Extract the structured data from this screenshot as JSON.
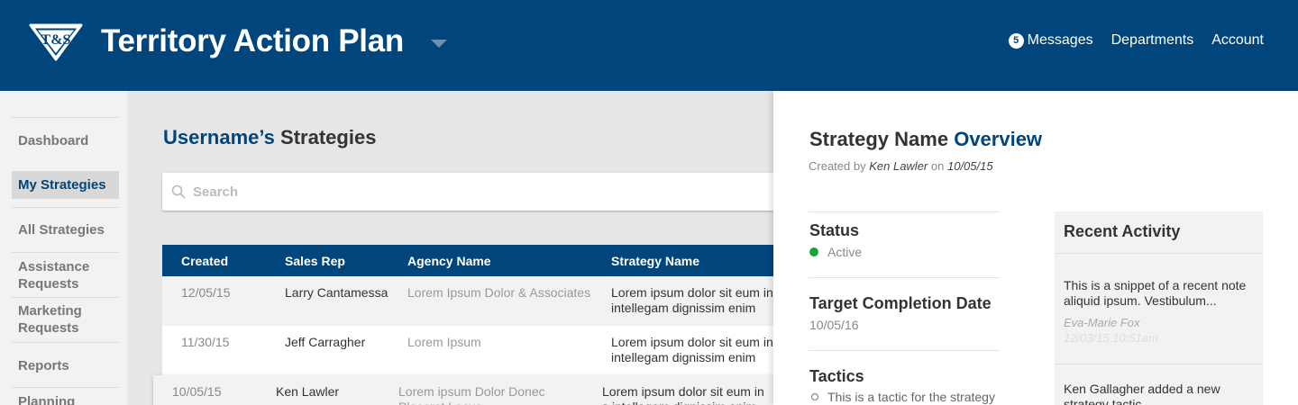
{
  "header": {
    "logo_text": "T&S",
    "title": "Territory Action Plan",
    "nav": {
      "messages_count": "5",
      "messages_label": "Messages",
      "departments_label": "Departments",
      "account_label": "Account"
    }
  },
  "sidebar": {
    "items": [
      {
        "label": "Dashboard",
        "active": false
      },
      {
        "label": "My Strategies",
        "active": true
      },
      {
        "label": "All Strategies",
        "active": false
      },
      {
        "label": "Assistance Requests",
        "active": false
      },
      {
        "label": "Marketing Requests",
        "active": false
      },
      {
        "label": "Reports",
        "active": false
      },
      {
        "label": "Planning",
        "active": false
      }
    ]
  },
  "main": {
    "title_user": "Username’s",
    "title_rest": "Strategies",
    "search": {
      "placeholder": "Search",
      "value": ""
    },
    "table": {
      "columns": [
        "Created",
        "Sales Rep",
        "Agency Name",
        "Strategy Name"
      ],
      "rows": [
        {
          "created": "12/05/15",
          "sales_rep": "Larry Cantamessa",
          "agency": "Lorem Ipsum Dolor & Associates",
          "strategy": "Lorem ipsum dolor sit eum in intellegam dignissim enim"
        },
        {
          "created": "11/30/15",
          "sales_rep": "Jeff Carragher",
          "agency": "Lorem Ipsum",
          "strategy": "Lorem ipsum dolor sit eum in intellegam dignissim enim"
        },
        {
          "created": "10/05/15",
          "sales_rep": "Ken Lawler",
          "agency": "Lorem ipsum Dolor Donec Placerat Lacus",
          "strategy": "Lorem ipsum dolor sit eum in s intellegam dignissim enim"
        }
      ]
    }
  },
  "panel": {
    "title_name": "Strategy Name",
    "title_accent": "Overview",
    "created_prefix": "Created by",
    "created_by": "Ken Lawler",
    "created_on_word": "on",
    "created_date": "10/05/15",
    "status_title": "Status",
    "status_value": "Active",
    "target_title": "Target Completion Date",
    "target_value": "10/05/16",
    "tactics_title": "Tactics",
    "tactics": [
      "This is a tactic for the strategy"
    ],
    "activity": {
      "title": "Recent Activity",
      "items": [
        {
          "text": "This is a snippet of a recent note aliquid ipsum. Vestibulum...",
          "author": "Eva-Marie Fox",
          "time": "12/03/15 10:51am"
        },
        {
          "text": "Ken Gallagher added a new strategy tactic"
        }
      ]
    }
  },
  "colors": {
    "brand_blue": "#00457c",
    "status_active": "#13a538",
    "sidebar_bg": "#f2f2f2",
    "main_bg": "#e6e6e6"
  }
}
